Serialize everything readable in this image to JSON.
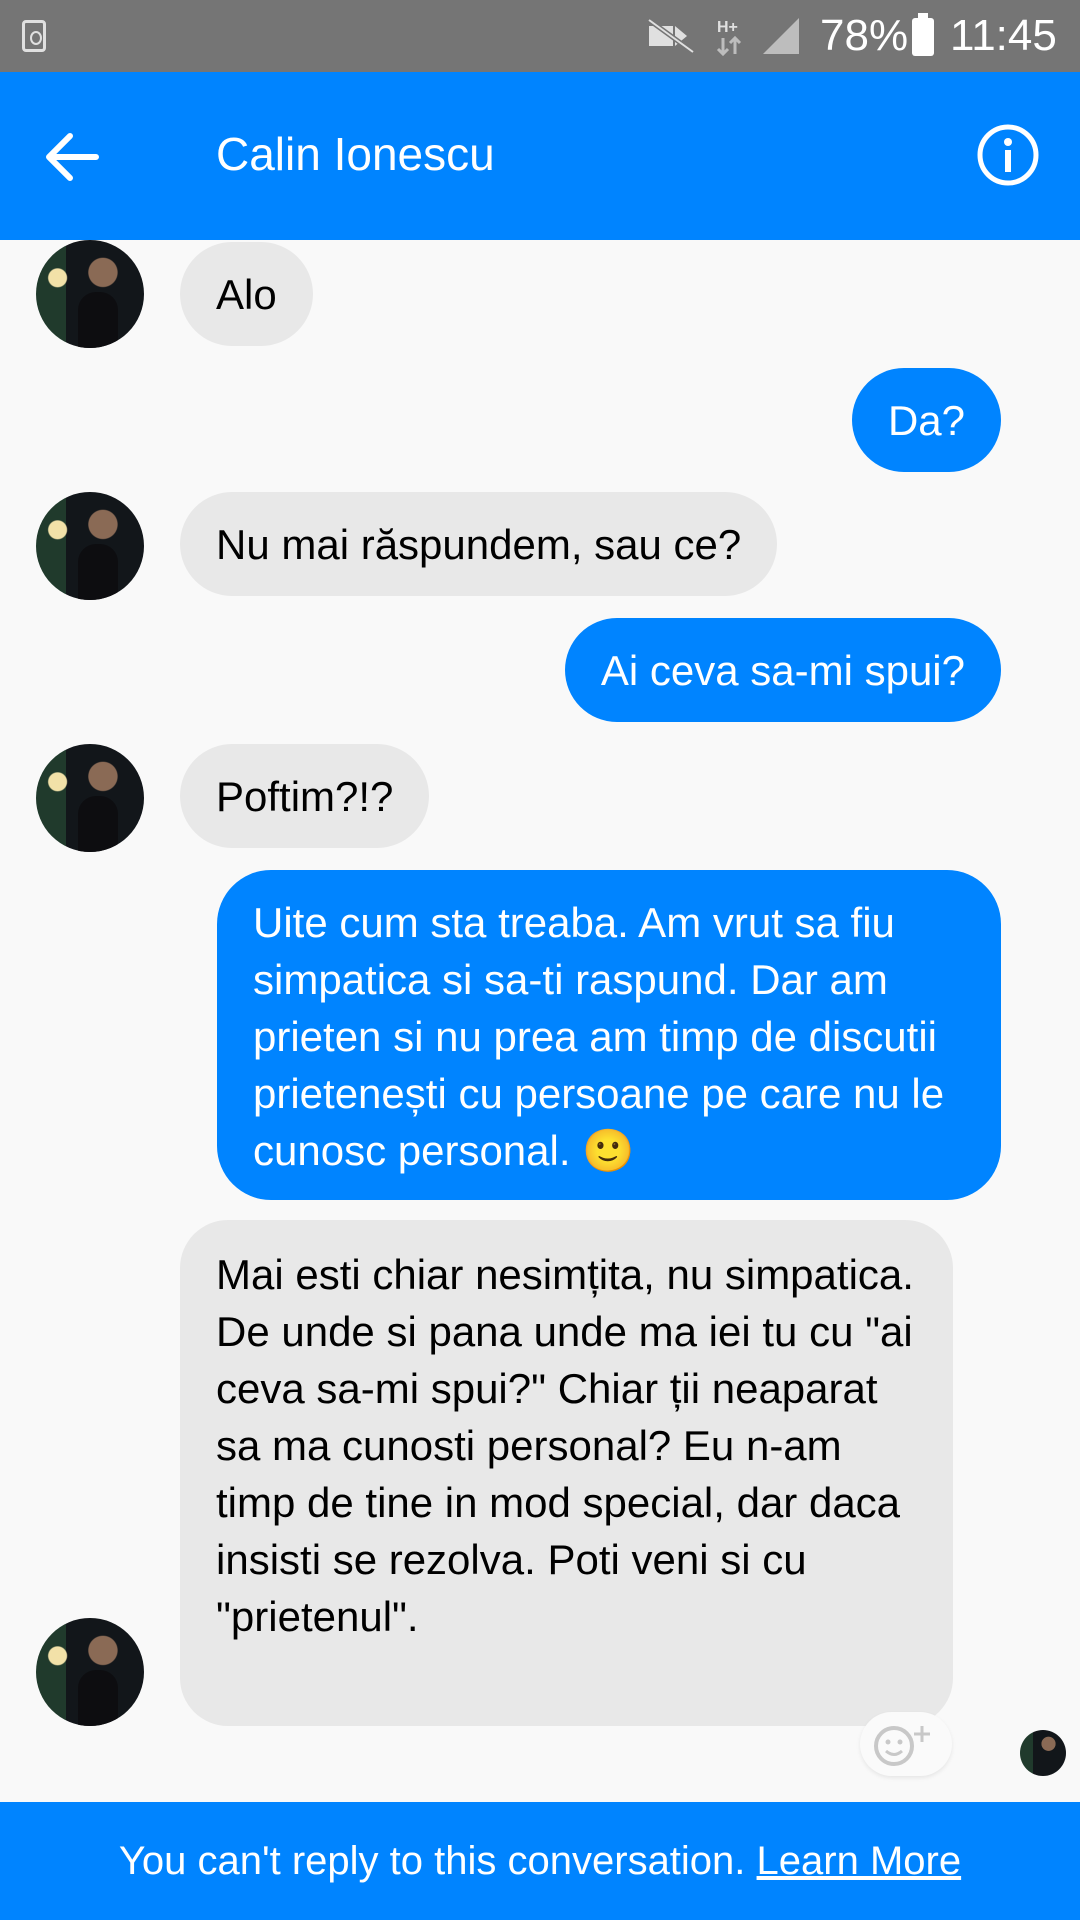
{
  "status_bar": {
    "battery": "78%",
    "time": "11:45",
    "icons": [
      "screenshot-icon",
      "mute-icon",
      "network-hplus-icon",
      "signal-icon",
      "battery-icon"
    ]
  },
  "header": {
    "title": "Calin Ionescu",
    "back_icon": "back-arrow-icon",
    "info_icon": "info-icon"
  },
  "messages": [
    {
      "sender": "them",
      "text": "Alo"
    },
    {
      "sender": "me",
      "text": "Da?"
    },
    {
      "sender": "them",
      "text": "Nu mai răspundem, sau ce?"
    },
    {
      "sender": "me",
      "text": "Ai ceva sa-mi spui?"
    },
    {
      "sender": "them",
      "text": "Poftim?!?"
    },
    {
      "sender": "me",
      "text": "Uite cum sta treaba. Am vrut sa fiu simpatica si sa-ti raspund. Dar am prieten si nu prea am timp de discutii prietenești cu persoane pe care nu le cunosc personal. 🙂"
    },
    {
      "sender": "them",
      "text": "Mai esti chiar nesimțita, nu simpatica. De unde si pana unde ma iei tu cu \"ai ceva sa-mi spui?\" Chiar ții neaparat sa ma cunosti personal? Eu n-am timp de tine in mod special, dar daca insisti se rezolva. Poti veni si cu \"prietenul\"."
    }
  ],
  "footer": {
    "text": "You can't reply to this conversation.",
    "link": "Learn More"
  },
  "colors": {
    "accent": "#0084ff",
    "incoming_bubble": "#e8e8e8",
    "status_bar": "#757575",
    "background": "#f9f9f9"
  }
}
